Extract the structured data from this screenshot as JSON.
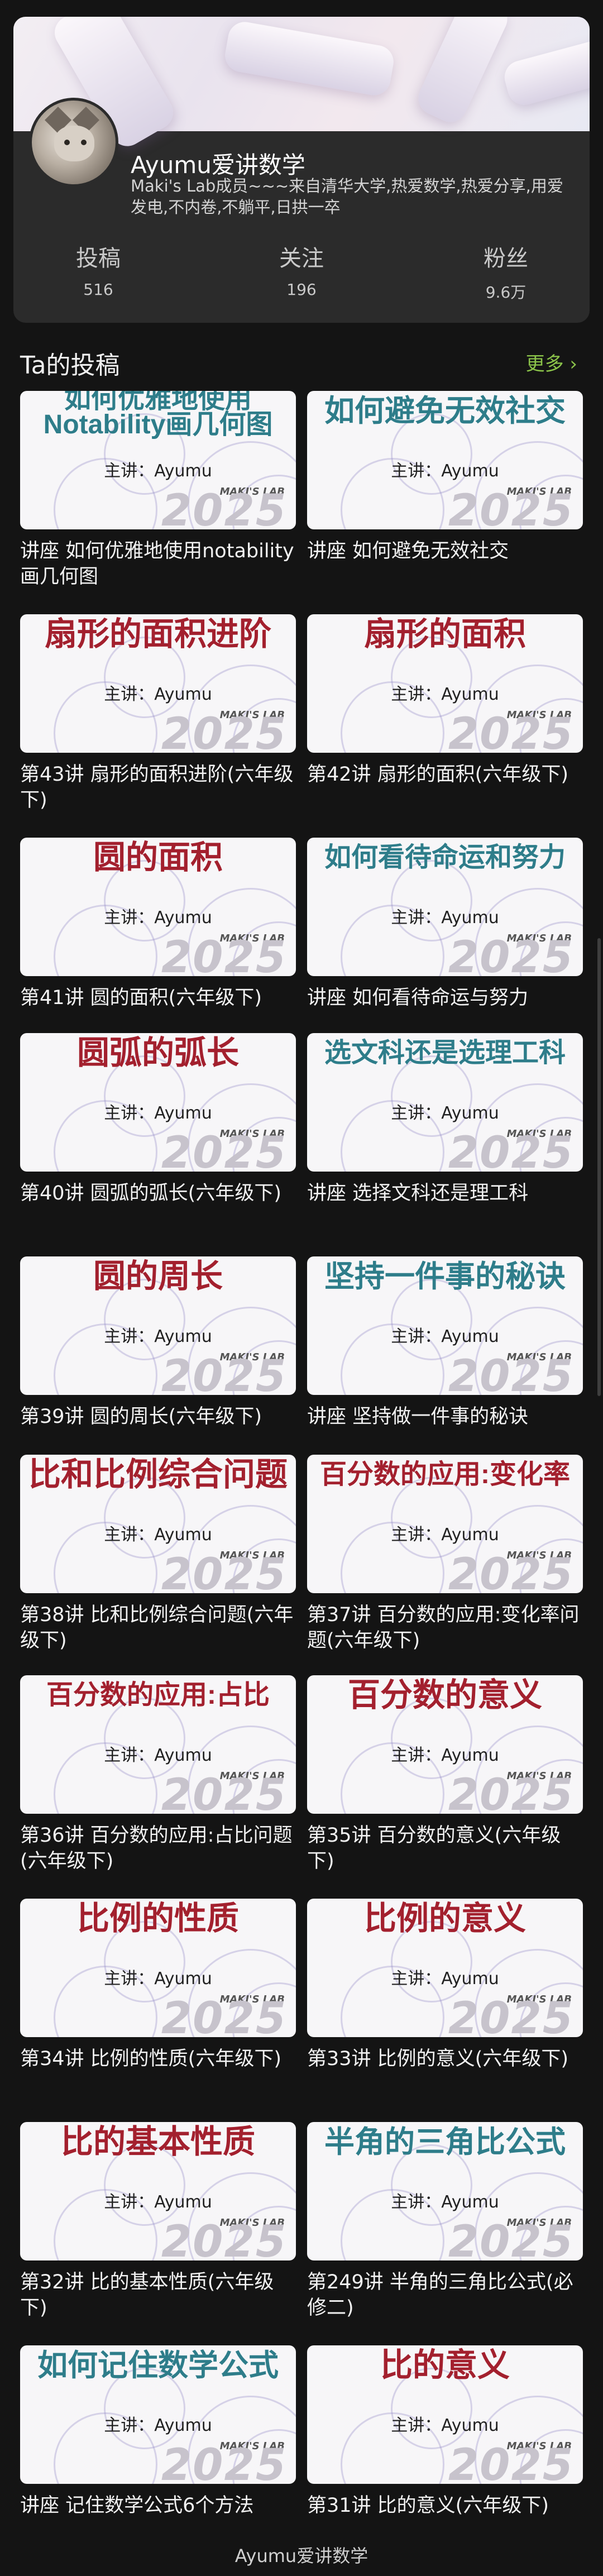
{
  "profile": {
    "name": "Ayumu爱讲数学",
    "bio": "Maki's Lab成员~~~来自清华大学,热爱数学,热爱分享,用爱发电,不内卷,不躺平,日拱一卒",
    "stats": [
      {
        "label": "投稿",
        "value": "516"
      },
      {
        "label": "关注",
        "value": "196"
      },
      {
        "label": "粉丝",
        "value": "9.6万"
      }
    ]
  },
  "section": {
    "title": "Ta的投稿",
    "more": "更多 ›"
  },
  "cover_common": {
    "speaker": "主讲：Ayumu",
    "lab": "MAKI'S LAB",
    "year": "2025"
  },
  "videos": [
    {
      "cover": "如何优雅地使用Notability画几何图",
      "cover_color": "teal",
      "title": "讲座 如何优雅地使用notability画几何图"
    },
    {
      "cover": "如何避免无效社交",
      "cover_color": "teal",
      "title": "讲座 如何避免无效社交"
    },
    {
      "cover": "扇形的面积进阶",
      "cover_color": "red",
      "title": "第43讲 扇形的面积进阶(六年级下)"
    },
    {
      "cover": "扇形的面积",
      "cover_color": "red",
      "title": "第42讲 扇形的面积(六年级下)"
    },
    {
      "cover": "圆的面积",
      "cover_color": "red",
      "title": "第41讲 圆的面积(六年级下)"
    },
    {
      "cover": "如何看待命运和努力",
      "cover_color": "teal",
      "title": "讲座 如何看待命运与努力"
    },
    {
      "cover": "圆弧的弧长",
      "cover_color": "red",
      "title": "第40讲 圆弧的弧长(六年级下)"
    },
    {
      "cover": "选文科还是选理工科",
      "cover_color": "teal",
      "title": "讲座 选择文科还是理工科"
    },
    {
      "cover": "圆的周长",
      "cover_color": "red",
      "title": "第39讲 圆的周长(六年级下)"
    },
    {
      "cover": "坚持一件事的秘诀",
      "cover_color": "teal",
      "title": "讲座 坚持做一件事的秘诀"
    },
    {
      "cover": "比和比例综合问题",
      "cover_color": "red",
      "title": "第38讲 比和比例综合问题(六年级下)"
    },
    {
      "cover": "百分数的应用:变化率",
      "cover_color": "red",
      "title": "第37讲 百分数的应用:变化率问题(六年级下)"
    },
    {
      "cover": "百分数的应用:占比",
      "cover_color": "red",
      "title": "第36讲 百分数的应用:占比问题(六年级下)"
    },
    {
      "cover": "百分数的意义",
      "cover_color": "red",
      "title": "第35讲 百分数的意义(六年级下)"
    },
    {
      "cover": "比例的性质",
      "cover_color": "red",
      "title": "第34讲 比例的性质(六年级下)"
    },
    {
      "cover": "比例的意义",
      "cover_color": "red",
      "title": "第33讲 比例的意义(六年级下)"
    },
    {
      "cover": "比的基本性质",
      "cover_color": "red",
      "title": "第32讲 比的基本性质(六年级下)"
    },
    {
      "cover": "半角的三角比公式",
      "cover_color": "teal",
      "title": "第249讲 半角的三角比公式(必修二)"
    },
    {
      "cover": "如何记住数学公式",
      "cover_color": "teal",
      "title": "讲座 记住数学公式6个方法"
    },
    {
      "cover": "比的意义",
      "cover_color": "red",
      "title": "第31讲 比的意义(六年级下)"
    }
  ],
  "footer": "Ayumu爱讲数学"
}
